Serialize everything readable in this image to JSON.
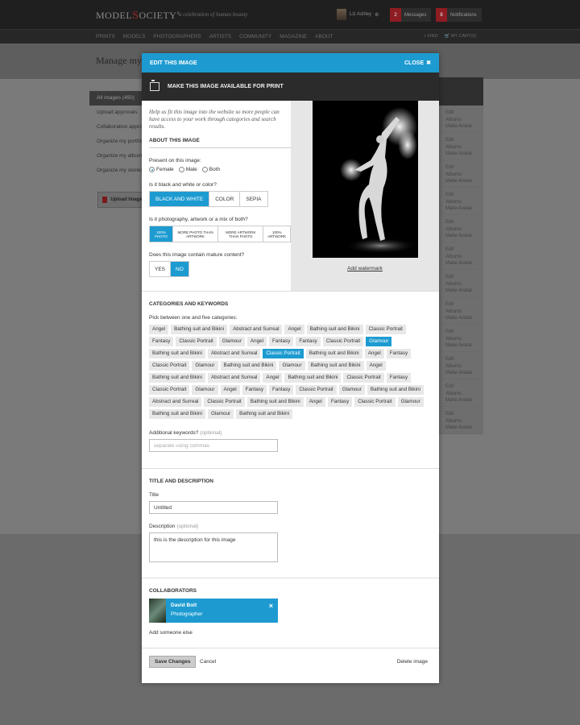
{
  "header": {
    "logo_left": "MODEL",
    "logo_s": "S",
    "logo_right": "OCIETY",
    "tagline": "a celebration of human beauty",
    "user_name": "Liz Ashley",
    "messages_count": "2",
    "messages_label": "Messages",
    "notifications_count": "8",
    "notifications_label": "Notifications"
  },
  "nav": {
    "items": [
      "PRINTS",
      "MODELS",
      "PHOTOGRAPHERS",
      "ARTISTS",
      "COMMUNITY",
      "MAGAZINE",
      "ABOUT"
    ],
    "find": "FIND",
    "cart": "MY CART(0)"
  },
  "page": {
    "title": "Manage my",
    "sidebar": [
      "All images (450)",
      "Upload approvals",
      "Collaboration approvals",
      "Organize my portfolio",
      "Organize my albums",
      "Organize my stories"
    ],
    "upload_label": "Upload Images",
    "row_links": [
      "Edit",
      "Albums",
      "Make Avatar"
    ]
  },
  "modal": {
    "title": "EDIT THIS IMAGE",
    "close": "CLOSE",
    "print_label": "MAKE THIS IMAGE AVAILABLE FOR PRINT",
    "intro": "Help us fit this image into the website so more people can have access to your work through categories and search results.",
    "about_title": "ABOUT THIS IMAGE",
    "present_q": "Present on this image:",
    "present_opts": [
      "Female",
      "Male",
      "Both"
    ],
    "present_selected": "Female",
    "bw_q": "Is it black and white or color?",
    "bw_opts": [
      "BLACK AND WHITE",
      "COLOR",
      "SEPIA"
    ],
    "bw_selected": "BLACK AND WHITE",
    "mix_q": "Is it photography, artwork or a mix of both?",
    "mix_opts": [
      "100% PHOTO",
      "MORE PHOTO THAN ARTWORK",
      "MORE ARTWORK THAN PHOTO",
      "100% ARTWORK"
    ],
    "mix_selected": "100% PHOTO",
    "mature_q": "Does this image contain mature content?",
    "mature_opts": [
      "YES",
      "NO"
    ],
    "mature_selected": "NO",
    "watermark": "Add watermark",
    "cat_title": "CATEGORIES AND KEYWORDS",
    "cat_hint": "Pick between one and five categories:",
    "tags": [
      "Angel",
      "Bathing suit and Bikini",
      "Abstract and Surreal",
      "Angel",
      "Bathing suit and Bikini",
      "Classic Portrait",
      "Fantasy",
      "Classic Portrait",
      "Glamour",
      "Angel",
      "Fantasy",
      "Fantasy",
      "Classic Portrait",
      "Glamour",
      "Bathing suit and Bikini",
      "Abstract and Surreal",
      "Classic Portrait",
      "Bathing suit and Bikini",
      "Angel",
      "Fantasy",
      "Classic Portrait",
      "Glamour",
      "Bathing suit and Bikini",
      "Glamour",
      "Bathing suit and Bikini",
      "Angel",
      "Bathing suit and Bikini",
      "Abstract and Surreal",
      "Angel",
      "Bathing suit and Bikini",
      "Classic Portrait",
      "Fantasy",
      "Classic Portrait",
      "Glamour",
      "Angel",
      "Fantasy",
      "Fantasy",
      "Classic Portrait",
      "Glamour",
      "Bathing suit and Bikini",
      "Abstract and Surreal",
      "Classic Portrait",
      "Bathing suit and Bikini",
      "Angel",
      "Fantasy",
      "Classic Portrait",
      "Glamour",
      "Bathing suit and Bikini",
      "Glamour",
      "Bathing suit and Bikini"
    ],
    "selected_tag_indices": [
      13,
      16
    ],
    "keywords_label": "Additional keywords?",
    "keywords_opt": "(optional)",
    "keywords_placeholder": "separate using commas",
    "td_title": "TITLE AND DESCRIPTION",
    "title_label": "Title",
    "title_value": "Untitled",
    "desc_label": "Description",
    "desc_opt": "(optional)",
    "desc_value": "this is the description for this image",
    "collab_title": "COLLABORATORS",
    "collab_name": "David Bolt",
    "collab_role": "Photographer",
    "add_someone": "Add someone else",
    "save": "Save Changes",
    "cancel": "Cancel",
    "delete": "Delete image"
  },
  "colors": {
    "accent": "#1d9bd1",
    "brand_red": "#a1272b",
    "dark": "#2b2b2b"
  }
}
